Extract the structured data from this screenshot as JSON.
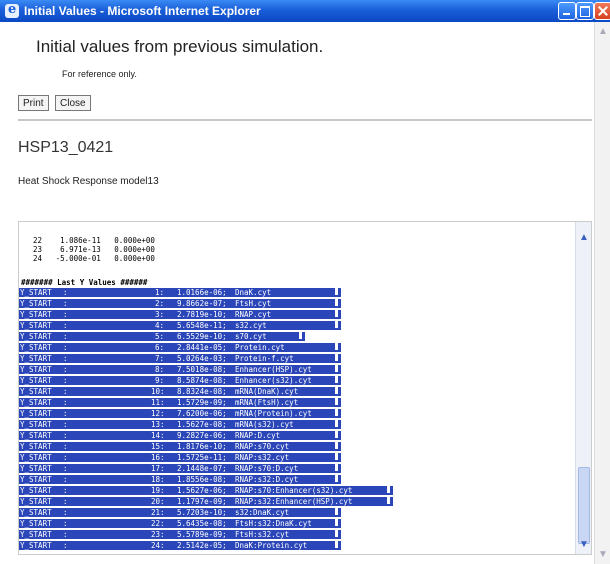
{
  "window": {
    "title": "Initial Values - Microsoft Internet Explorer"
  },
  "page": {
    "heading": "Initial values from previous simulation.",
    "note": "For reference only.",
    "print_label": "Print",
    "close_label": "Close",
    "model_id": "HSP13_0421",
    "model_desc": "Heat Shock Response model13"
  },
  "data_panel": {
    "prev_rows": [
      "22    1.086e-11   0.000e+00",
      "23    6.971e-13   0.000e+00",
      "24   -5.000e-01   0.000e+00"
    ],
    "header": "####### Last Y Values ######",
    "rows": [
      {
        "start": "Y_START",
        "colon": ":",
        "idx": "1:",
        "val": "1.0166e-06;",
        "name": "DnaK.cyt"
      },
      {
        "start": "Y_START",
        "colon": ":",
        "idx": "2:",
        "val": "9.8662e-07;",
        "name": "FtsH.cyt"
      },
      {
        "start": "Y_START",
        "colon": ":",
        "idx": "3:",
        "val": "2.7819e-10;",
        "name": "RNAP.cyt"
      },
      {
        "start": "Y_START",
        "colon": ":",
        "idx": "4:",
        "val": "5.6548e-11;",
        "name": "s32.cyt"
      },
      {
        "start": "Y_START",
        "colon": ":",
        "idx": "5:",
        "val": "6.5529e-10;",
        "name": "s70.cyt"
      },
      {
        "start": "Y_START",
        "colon": ":",
        "idx": "6:",
        "val": "2.8441e-05;",
        "name": "Protein.cyt"
      },
      {
        "start": "Y_START",
        "colon": ":",
        "idx": "7:",
        "val": "5.0264e-03;",
        "name": "Protein-f.cyt"
      },
      {
        "start": "Y_START",
        "colon": ":",
        "idx": "8:",
        "val": "7.5018e-08;",
        "name": "Enhancer(HSP).cyt"
      },
      {
        "start": "Y_START",
        "colon": ":",
        "idx": "9:",
        "val": "8.5874e-08;",
        "name": "Enhancer(s32).cyt"
      },
      {
        "start": "Y_START",
        "colon": ":",
        "idx": "10:",
        "val": "8.8324e-08;",
        "name": "mRNA(DnaK).cyt"
      },
      {
        "start": "Y_START",
        "colon": ":",
        "idx": "11:",
        "val": "1.5729e-09;",
        "name": "mRNA(FtsH).cyt"
      },
      {
        "start": "Y_START",
        "colon": ":",
        "idx": "12:",
        "val": "7.6200e-06;",
        "name": "mRNA(Protein).cyt"
      },
      {
        "start": "Y_START",
        "colon": ":",
        "idx": "13:",
        "val": "1.5627e-08;",
        "name": "mRNA(s32).cyt"
      },
      {
        "start": "Y_START",
        "colon": ":",
        "idx": "14:",
        "val": "9.2827e-06;",
        "name": "RNAP:D.cyt"
      },
      {
        "start": "Y_START",
        "colon": ":",
        "idx": "15:",
        "val": "1.8176e-10;",
        "name": "RNAP:s70.cyt"
      },
      {
        "start": "Y_START",
        "colon": ":",
        "idx": "16:",
        "val": "1.5725e-11;",
        "name": "RNAP:s32.cyt"
      },
      {
        "start": "Y_START",
        "colon": ":",
        "idx": "17:",
        "val": "2.1448e-07;",
        "name": "RNAP:s70:D.cyt"
      },
      {
        "start": "Y_START",
        "colon": ":",
        "idx": "18:",
        "val": "1.8556e-08;",
        "name": "RNAP:s32:D.cyt"
      },
      {
        "start": "Y_START",
        "colon": ":",
        "idx": "19:",
        "val": "1.5627e-06;",
        "name": "RNAP:s70:Enhancer(s32).cyt"
      },
      {
        "start": "Y_START",
        "colon": ":",
        "idx": "20:",
        "val": "1.1797e-09;",
        "name": "RNAP:s32:Enhancer(HSP).cyt"
      },
      {
        "start": "Y_START",
        "colon": ":",
        "idx": "21:",
        "val": "5.7203e-10;",
        "name": "s32:DnaK.cyt"
      },
      {
        "start": "Y_START",
        "colon": ":",
        "idx": "22:",
        "val": "5.6435e-08;",
        "name": "FtsH:s32:DnaK.cyt"
      },
      {
        "start": "Y_START",
        "colon": ":",
        "idx": "23:",
        "val": "5.5789e-09;",
        "name": "FtsH:s32.cyt"
      },
      {
        "start": "Y_START",
        "colon": ":",
        "idx": "24:",
        "val": "2.5142e-05;",
        "name": "DnaK:Protein.cyt"
      }
    ]
  }
}
